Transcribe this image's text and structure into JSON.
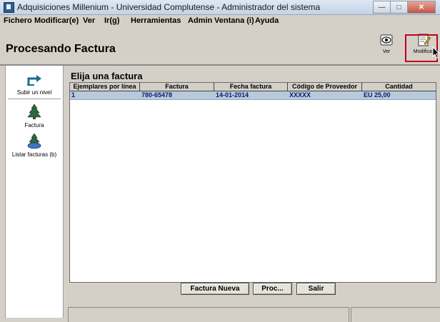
{
  "window": {
    "title": "Adquisiciones Millenium - Universidad Complutense - Administrador del sistema"
  },
  "menu": [
    "Fichero",
    "Modificar(e)",
    "Ver",
    "Ir(g)",
    "Herramientas",
    "Admin",
    "Ventana (i)",
    "Ayuda"
  ],
  "page": {
    "title": "Procesando Factura"
  },
  "toolbar": {
    "ver_label": "Ver",
    "modificar_label": "Modificar"
  },
  "sidebar": {
    "items": [
      {
        "label": "Subir un nivel",
        "icon": "up-level-icon"
      },
      {
        "label": "Factura",
        "icon": "invoice-tree-icon"
      },
      {
        "label": "Listar facturas (b)",
        "icon": "list-invoices-icon"
      }
    ]
  },
  "main": {
    "label": "Elija una factura",
    "columns": [
      "Ejemplares por línea",
      "Factura",
      "Fecha factura",
      "Código de Proveedor",
      "Cantidad"
    ],
    "rows": [
      {
        "ejemplares": "1",
        "factura": "780-65478",
        "fecha": "14-01-2014",
        "codigo": "XXXXX",
        "cantidad": "EU 25,00"
      }
    ]
  },
  "buttons": {
    "nueva": "Factura Nueva",
    "proc": "Proc...",
    "salir": "Salir"
  },
  "colors": {
    "selected_row": "#b9c9dc",
    "highlight_border": "#c4001a"
  }
}
